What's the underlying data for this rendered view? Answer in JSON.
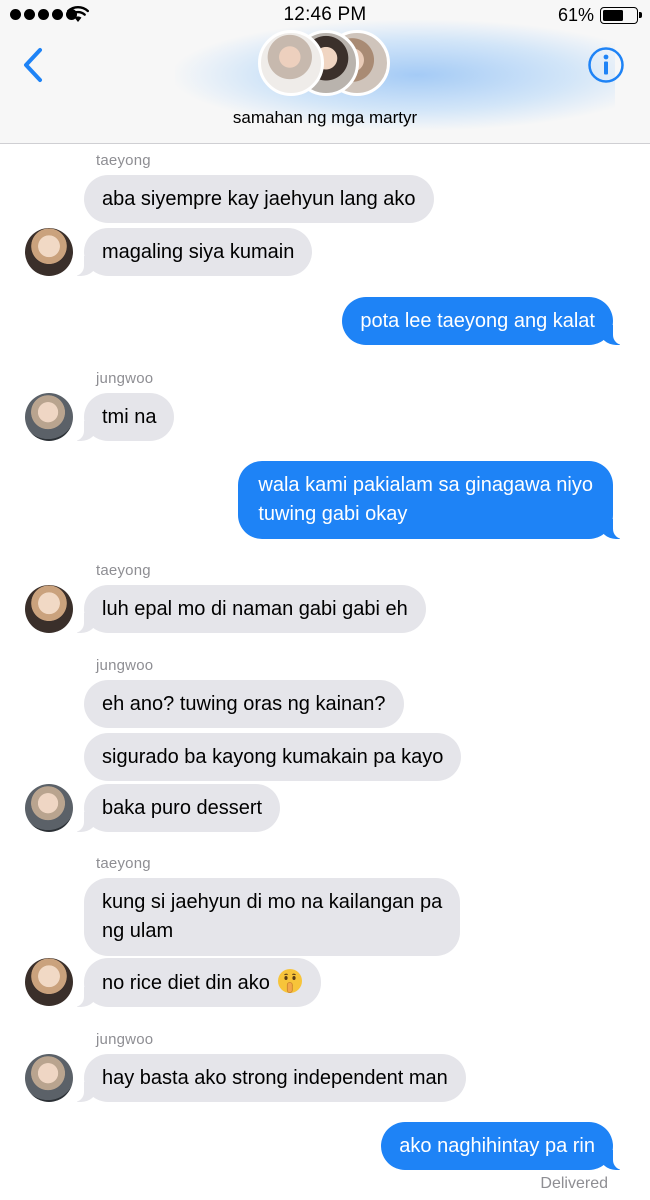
{
  "status_bar": {
    "time": "12:46 PM",
    "battery": "61%",
    "battery_level": 0.61,
    "signal_icon": "signal-dots-icon",
    "wifi_icon": "wifi-icon"
  },
  "header": {
    "title": "samahan ng mga martyr",
    "back_icon": "chevron-left-icon",
    "info_icon": "info-icon",
    "accent_color": "#1e83f6"
  },
  "conversation": {
    "incoming_color": "#e5e5ea",
    "outgoing_color": "#1e83f6",
    "sender_labels": [
      "taeyong",
      "jungwoo",
      "taeyong",
      "jungwoo",
      "taeyong",
      "jungwoo"
    ],
    "messages": [
      "aba siyempre kay jaehyun lang ako",
      "magaling siya kumain",
      "pota lee taeyong ang kalat",
      "tmi na",
      "wala kami pakialam sa ginagawa niyo",
      "tuwing gabi okay",
      "luh epal mo di naman gabi gabi eh",
      "eh ano? tuwing oras ng kainan?",
      "sigurado ba kayong kumakain pa kayo",
      "baka puro dessert",
      "kung si jaehyun di mo na kailangan pa",
      "ng ulam",
      "no rice diet din ako",
      "hay basta ako strong independent man",
      "ako naghihintay pa rin"
    ],
    "emoji": "shushing-face-icon",
    "status": "Delivered"
  }
}
